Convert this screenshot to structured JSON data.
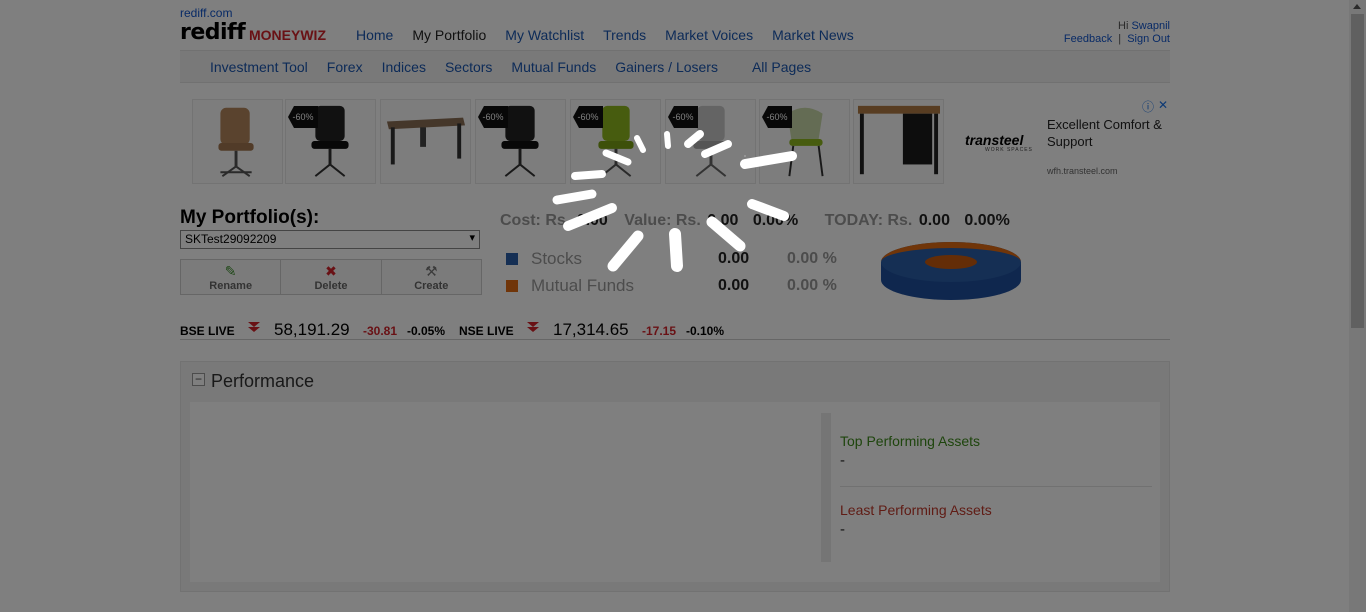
{
  "header": {
    "site_link": "rediff.com",
    "logo_main": "rediff",
    "logo_sub": "MONEYWIZ",
    "nav": [
      "Home",
      "My Portfolio",
      "My Watchlist",
      "Trends",
      "Market Voices",
      "Market News"
    ],
    "active_nav": "My Portfolio",
    "greeting": "Hi",
    "username": "Swapnil",
    "feedback": "Feedback",
    "separator": "|",
    "signout": "Sign Out"
  },
  "subnav": [
    "Investment Tool",
    "Forex",
    "Indices",
    "Sectors",
    "Mutual Funds",
    "Gainers / Losers"
  ],
  "subnav_all": "All Pages",
  "ad": {
    "discount_tags": [
      "-60%",
      "-60%",
      "-60%",
      "-60%",
      "-60%"
    ],
    "brand": "transteel",
    "brand_sub": "WORK SPACES",
    "headline": "Excellent Comfort & Support",
    "url": "wfh.transteel.com",
    "info_icon": "ⓘ",
    "close_icon": "✕"
  },
  "portfolio": {
    "title": "My Portfolio(s):",
    "selected": "SKTest29092209",
    "buttons": {
      "rename": "Rename",
      "delete": "Delete",
      "create": "Create"
    }
  },
  "summary": {
    "cost_label": "Cost: Rs.",
    "cost_value": "0.00",
    "value_label": "Value: Rs.",
    "value_value": "0.00",
    "value_pct": "0.00%",
    "today_label": "TODAY: Rs.",
    "today_value": "0.00",
    "today_pct": "0.00%"
  },
  "allocation": [
    {
      "name": "Stocks",
      "value": "0.00",
      "pct": "0.00 %",
      "color": "#2a5fa8"
    },
    {
      "name": "Mutual Funds",
      "value": "0.00",
      "pct": "0.00 %",
      "color": "#e06a12"
    }
  ],
  "ticker": {
    "bse_label": "BSE LIVE",
    "bse_value": "58,191.29",
    "bse_change": "-30.81",
    "bse_pct": "-0.05%",
    "nse_label": "NSE LIVE",
    "nse_value": "17,314.65",
    "nse_change": "-17.15",
    "nse_pct": "-0.10%"
  },
  "performance": {
    "toggle": "−",
    "title": "Performance",
    "top_label": "Top Performing Assets",
    "top_value": "-",
    "least_label": "Least Performing Assets",
    "least_value": "-"
  },
  "colors": {
    "accent_red": "#d2232a",
    "link_blue": "#1a56b0",
    "top_green": "#3d8a1a",
    "least_red": "#c0392b"
  }
}
